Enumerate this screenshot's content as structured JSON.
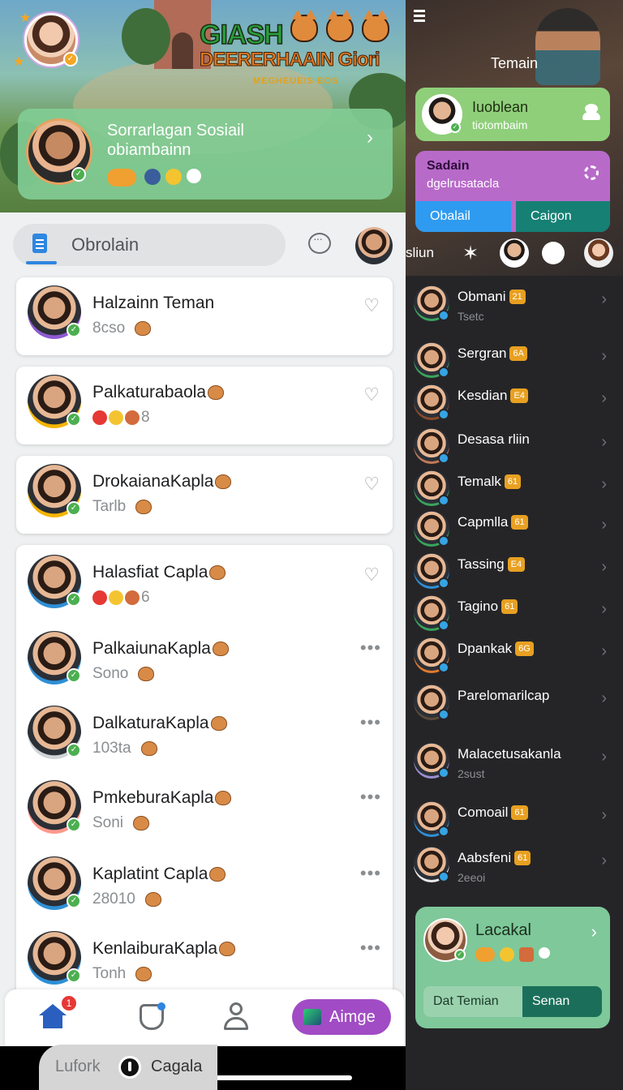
{
  "banner": {
    "title": "GIASH",
    "title_line2": "DEERERHAAIN Giori",
    "subtitle": "MEGHEUEIS EOS"
  },
  "social_card": {
    "title": "Sorrarlagan Sosiail",
    "subtitle": "obiambainn",
    "chevron": "›"
  },
  "tab": {
    "label": "Obrolain"
  },
  "friends_left": [
    {
      "name": "Halzainn Teman",
      "sub": "8cso",
      "action": "heart",
      "color": "#8e5bd1"
    },
    {
      "name": "Palkaturabaola",
      "sub": "8",
      "action": "heart",
      "color": "#f4b400"
    },
    {
      "name": "DrokaianaKapla",
      "sub": "Tarlb",
      "action": "heart",
      "color": "#f4b400"
    },
    {
      "name": "Halasfiat Capla",
      "sub": "6",
      "action": "heart",
      "color": "#2e8fd6"
    },
    {
      "name": "PalkaiunaKapla",
      "sub": "Sono",
      "action": "dots",
      "color": "#2e8fd6"
    },
    {
      "name": "DalkaturaKapla",
      "sub": "103ta",
      "action": "dots",
      "color": "#d0d3d6"
    },
    {
      "name": "PmkeburaKapla",
      "sub": "Soni",
      "action": "dots",
      "color": "#ff9a8b"
    },
    {
      "name": "Kaplatint Capla",
      "sub": "28010",
      "action": "dots",
      "color": "#2e8fd6"
    },
    {
      "name": "KenlaiburaKapla",
      "sub": "Tonh",
      "action": "dots",
      "color": "#2e8fd6"
    }
  ],
  "nav": {
    "home_badge": "1",
    "image_button": "Aimge"
  },
  "right": {
    "title": "Temain",
    "invite": {
      "title": "Iuoblean",
      "sub": "tiotombaim"
    },
    "search": {
      "title": "Sadain",
      "sub": "dgelrusatacla",
      "btn1": "Obalail",
      "btn2": "Caigon"
    },
    "mini_label": "sliun",
    "friends": [
      {
        "name": "Obmani",
        "badge": "21",
        "sub": "Tsetc",
        "color": "#3aa35c"
      },
      {
        "name": "Sergran",
        "badge": "6A",
        "sub": "",
        "color": "#3aa35c"
      },
      {
        "name": "Kesdian",
        "badge": "E4",
        "sub": "",
        "color": "#8a4b2b"
      },
      {
        "name": "Desasa rliin",
        "badge": "",
        "sub": "",
        "color": "#c07a5a"
      },
      {
        "name": "Temalk",
        "badge": "61",
        "sub": "",
        "color": "#3aa35c"
      },
      {
        "name": "Capmlla",
        "badge": "61",
        "sub": "",
        "color": "#3aa35c"
      },
      {
        "name": "Tassing",
        "badge": "E4",
        "sub": "",
        "color": "#2e8fd6"
      },
      {
        "name": "Tagino",
        "badge": "61",
        "sub": "",
        "color": "#3aa35c"
      },
      {
        "name": "Dpankak",
        "badge": "6G",
        "sub": "",
        "color": "#e07a2e"
      },
      {
        "name": "Parelomarilcap",
        "badge": "",
        "sub": "",
        "color": "#5a4a3a"
      },
      {
        "name": "Malacetusakanla",
        "badge": "",
        "sub": "2sust",
        "color": "#9b8fd1"
      },
      {
        "name": "Comoail",
        "badge": "61",
        "sub": "",
        "color": "#2e8fd6"
      },
      {
        "name": "Aabsfeni",
        "badge": "61",
        "sub": "2eeoi",
        "color": "#e9e9e9"
      }
    ],
    "local_card": {
      "title": "Lacakal",
      "btn1": "Dat Temian",
      "btn2": "Senan"
    },
    "bottom": {
      "left": "Lufork",
      "right": "Cagala"
    }
  }
}
